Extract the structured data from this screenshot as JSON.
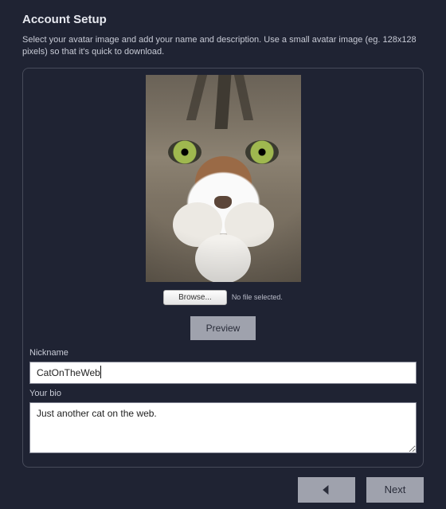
{
  "header": {
    "title": "Account Setup",
    "description": "Select your avatar image and add your name and description. Use a small avatar image (eg. 128x128 pixels) so that it's quick to download."
  },
  "avatar": {
    "browse_label": "Browse...",
    "file_status": "No file selected.",
    "preview_label": "Preview"
  },
  "fields": {
    "nickname_label": "Nickname",
    "nickname_value": "CatOnTheWeb",
    "bio_label": "Your bio",
    "bio_value": "Just another cat on the web."
  },
  "footer": {
    "back_label": "◀",
    "next_label": "Next"
  }
}
